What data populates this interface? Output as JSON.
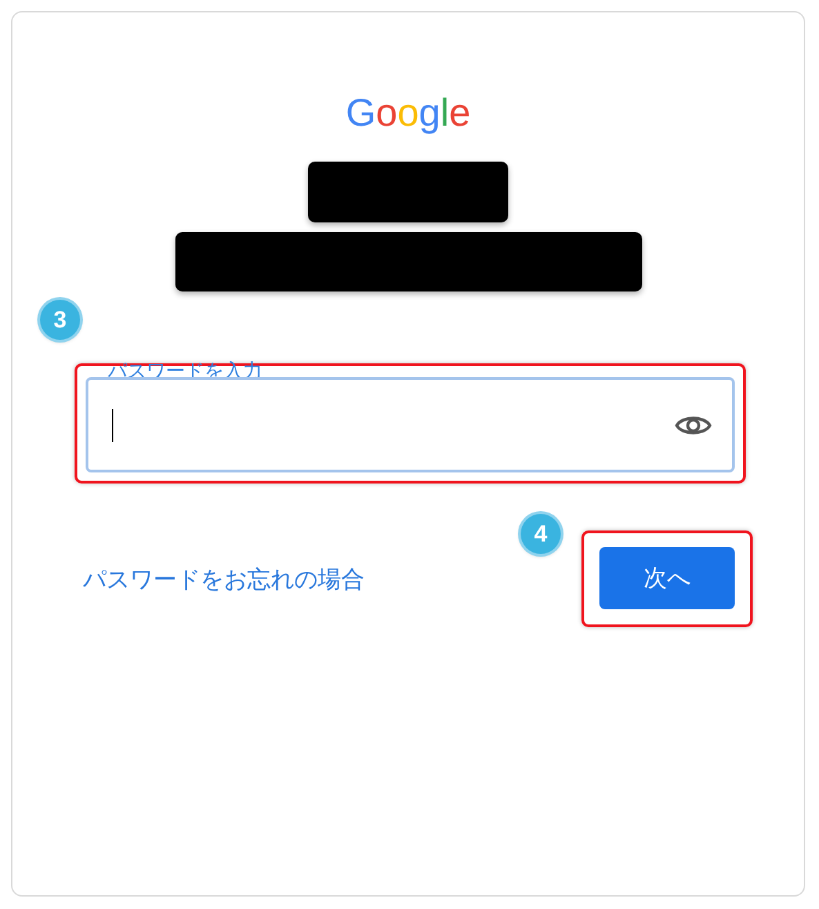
{
  "logo": {
    "letters": [
      {
        "text": "G",
        "color": "#4285f4"
      },
      {
        "text": "o",
        "color": "#ea4335"
      },
      {
        "text": "o",
        "color": "#fbbc05"
      },
      {
        "text": "g",
        "color": "#4285f4"
      },
      {
        "text": "l",
        "color": "#34a853"
      },
      {
        "text": "e",
        "color": "#ea4335"
      }
    ]
  },
  "password_field": {
    "step": "3",
    "label": "パスワードを入力",
    "focused": true
  },
  "forgot_link": "パスワードをお忘れの場合",
  "next_button": {
    "step": "4",
    "label": "次へ"
  }
}
